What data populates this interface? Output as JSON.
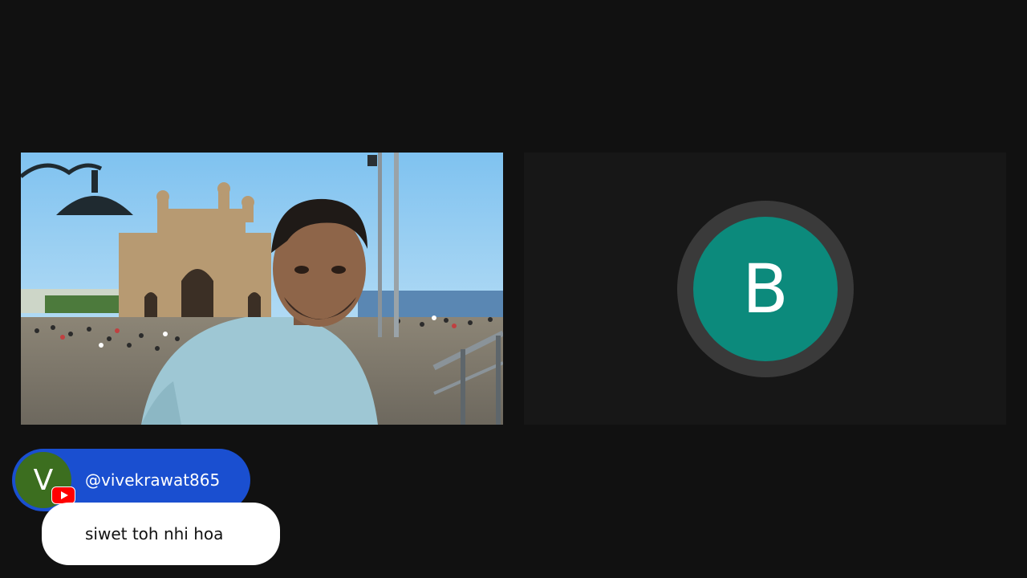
{
  "participants": {
    "video_tile": {
      "kind": "camera-video"
    },
    "avatar_tile": {
      "initial": "B",
      "avatar_color": "#0c8a7c"
    }
  },
  "comment": {
    "avatar_initial": "V",
    "avatar_color": "#3c6e1f",
    "platform_icon": "youtube-icon",
    "handle": "@vivekrawat865",
    "message": "siwet toh nhi hoa"
  },
  "colors": {
    "background": "#111111",
    "tile_background": "#171717",
    "handle_pill": "#1a4fd0",
    "message_bubble": "#ffffff"
  }
}
